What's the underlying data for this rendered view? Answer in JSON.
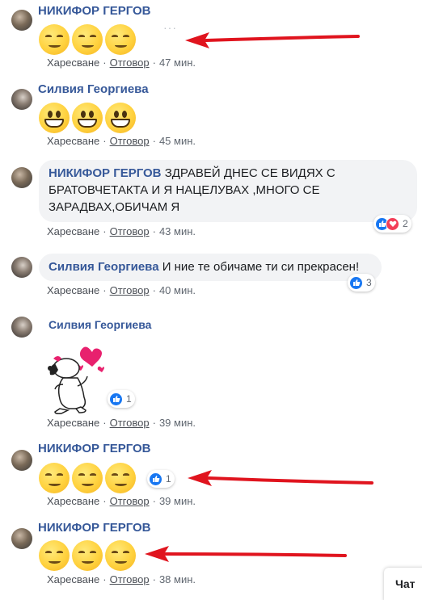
{
  "comments": [
    {
      "author": "НИКИФОР ГЕРГОВ",
      "like": "Харесване",
      "reply": "Отговор",
      "time": "47 мин."
    },
    {
      "author": "Силвия Георгиева",
      "like": "Харесване",
      "reply": "Отговор",
      "time": "45 мин."
    },
    {
      "author": "НИКИФОР ГЕРГОВ",
      "text": "ЗДРАВЕЙ ДНЕС СЕ ВИДЯХ С БРАТОВЧЕТАКТА И Я НАЦЕЛУВАХ ,МНОГО СЕ ЗАРАДВАХ,ОБИЧАМ Я",
      "text_line1": "ЗДРАВЕЙ ДНЕС СЕ ВИДЯХ С",
      "text_line2": "БРАТОВЧЕТАКТА И Я НАЦЕЛУВАХ ,МНОГО СЕ",
      "text_line3": "ЗАРАДВАХ,ОБИЧАМ Я",
      "reactions": "2",
      "like": "Харесване",
      "reply": "Отговор",
      "time": "43 мин."
    },
    {
      "author": "Силвия Георгиева",
      "text": "И ние те обичаме ти си прекрасен!",
      "reactions": "3",
      "like": "Харесване",
      "reply": "Отговор",
      "time": "40 мин."
    },
    {
      "author": "Силвия Георгиева",
      "reactions": "1",
      "like": "Харесване",
      "reply": "Отговор",
      "time": "39 мин."
    },
    {
      "author": "НИКИФОР ГЕРГОВ",
      "reactions": "1",
      "like": "Харесване",
      "reply": "Отговор",
      "time": "39 мин."
    },
    {
      "author": "НИКИФОР ГЕРГОВ",
      "like": "Харесване",
      "reply": "Отговор",
      "time": "38 мин."
    }
  ],
  "more_label": "···",
  "chat_label": "Чат",
  "colors": {
    "link_name": "#365899",
    "arrow": "#e0141e",
    "like_blue": "#1877f2",
    "love_red": "#f33e58"
  },
  "icons": [
    "like-icon",
    "love-icon",
    "smiling-emoji-icon",
    "grinning-emoji-icon",
    "snoopy-sticker",
    "more-options-icon",
    "red-arrow"
  ]
}
